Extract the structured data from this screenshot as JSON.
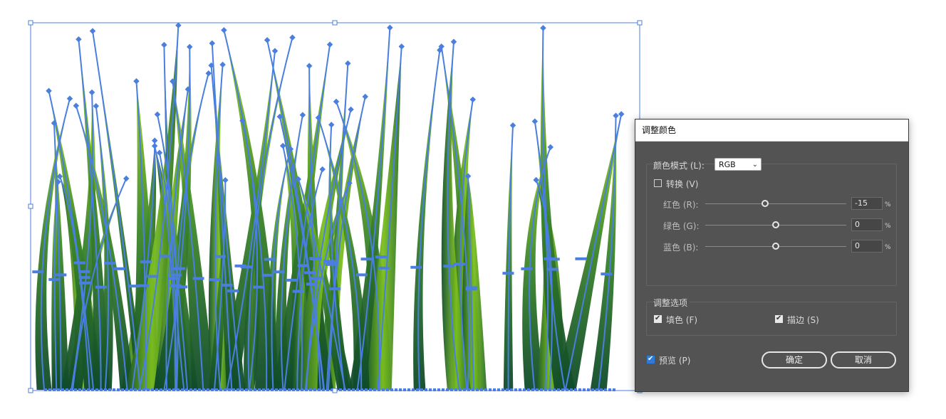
{
  "dialog": {
    "title": "调整颜色",
    "color_mode_label": "颜色模式 (L):",
    "color_mode_value": "RGB",
    "convert_label": "转换 (V)",
    "convert_checked": false,
    "sliders": [
      {
        "label": "红色 (R):",
        "value": "-15",
        "unit": "%",
        "level": -15
      },
      {
        "label": "绿色 (G):",
        "value": "0",
        "unit": "%",
        "level": 0
      },
      {
        "label": "蓝色 (B):",
        "value": "0",
        "unit": "%",
        "level": 0
      }
    ],
    "options_title": "调整选项",
    "fill_label": "填色 (F)",
    "fill_checked": true,
    "stroke_label": "描边 (S)",
    "stroke_checked": true,
    "preview_label": "预览 (P)",
    "preview_checked": true,
    "ok_label": "确定",
    "cancel_label": "取消"
  },
  "colors": {
    "selection": "#4a7fe0",
    "grass_dark": "#0f4a2a",
    "grass_mid": "#4f9a2a",
    "grass_light": "#9ad21a",
    "dialog_bg": "#535353",
    "preview_check": "#2f7ad6"
  },
  "icons": {
    "select_caret": "chevron-down-icon",
    "checkmark": "checkmark-icon"
  }
}
